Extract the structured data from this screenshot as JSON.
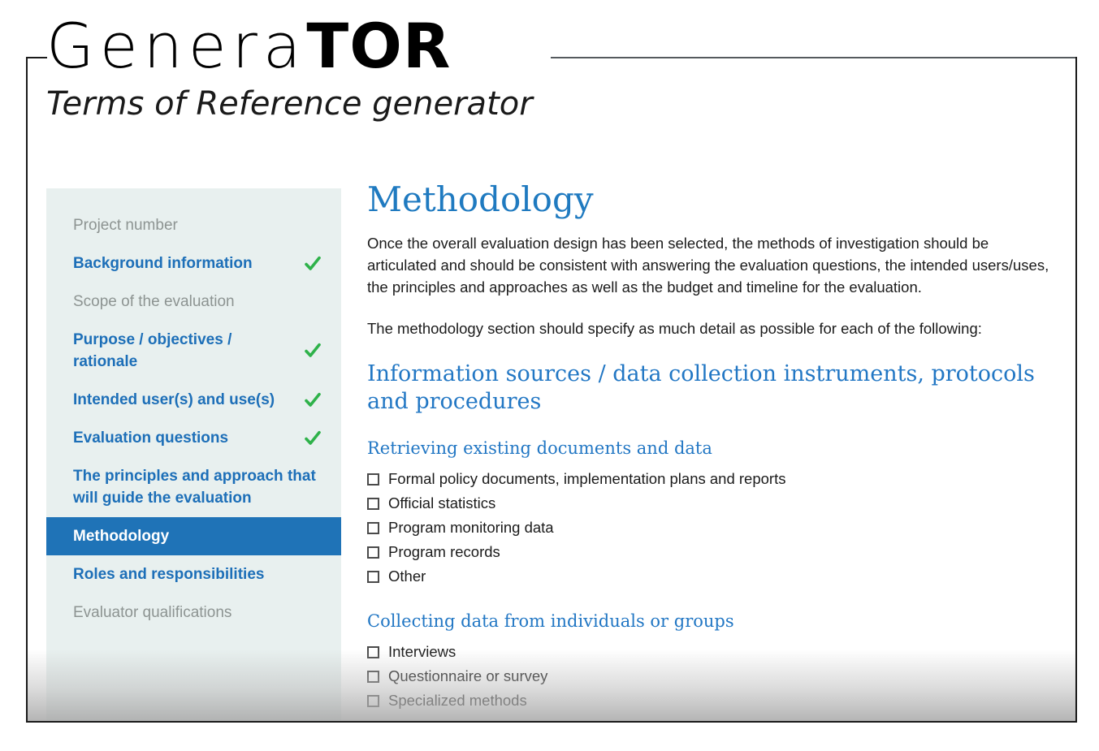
{
  "brand": {
    "title_light": "Genera",
    "title_bold": "TOR",
    "subtitle": "Terms of Reference generator"
  },
  "colors": {
    "accent_blue": "#1d6fb8",
    "active_blue": "#1f73b7",
    "heading_blue": "#2277c4",
    "check_green": "#2eb24a",
    "sidebar_bg": "#e8f0ef",
    "muted_text": "#8d9492"
  },
  "sidebar": {
    "items": [
      {
        "label": "Project number",
        "state": "muted",
        "completed": false,
        "active": false
      },
      {
        "label": "Background information",
        "state": "normal",
        "completed": true,
        "active": false
      },
      {
        "label": "Scope of the evaluation",
        "state": "muted",
        "completed": false,
        "active": false
      },
      {
        "label": "Purpose / objectives / rationale",
        "state": "normal",
        "completed": true,
        "active": false
      },
      {
        "label": "Intended user(s) and use(s)",
        "state": "normal",
        "completed": true,
        "active": false
      },
      {
        "label": "Evaluation questions",
        "state": "normal",
        "completed": true,
        "active": false
      },
      {
        "label": "The principles and approach that will guide the evaluation",
        "state": "normal",
        "completed": false,
        "active": false
      },
      {
        "label": "Methodology",
        "state": "normal",
        "completed": false,
        "active": true
      },
      {
        "label": "Roles and responsibilities",
        "state": "normal",
        "completed": false,
        "active": false
      },
      {
        "label": "Evaluator qualifications",
        "state": "muted",
        "completed": false,
        "active": false
      }
    ]
  },
  "main": {
    "title": "Methodology",
    "intro_paragraph": "Once the overall evaluation design has been selected, the methods of investigation should be articulated and should be consistent with answering the evaluation questions, the intended users/uses, the principles and approaches as well as the budget and timeline for the evaluation.",
    "lead_in": "The methodology section should specify as much detail as possible for each of the following:",
    "section_heading": "Information sources / data collection instruments, protocols and procedures",
    "groups": [
      {
        "heading": "Retrieving existing documents and data",
        "options": [
          {
            "label": "Formal policy documents, implementation plans and reports",
            "checked": false
          },
          {
            "label": "Official statistics",
            "checked": false
          },
          {
            "label": "Program monitoring data",
            "checked": false
          },
          {
            "label": "Program records",
            "checked": false
          },
          {
            "label": "Other",
            "checked": false
          }
        ]
      },
      {
        "heading": "Collecting data from individuals or groups",
        "options": [
          {
            "label": "Interviews",
            "checked": false
          },
          {
            "label": "Questionnaire or survey",
            "checked": false
          },
          {
            "label": "Specialized methods",
            "checked": false
          }
        ]
      }
    ]
  }
}
